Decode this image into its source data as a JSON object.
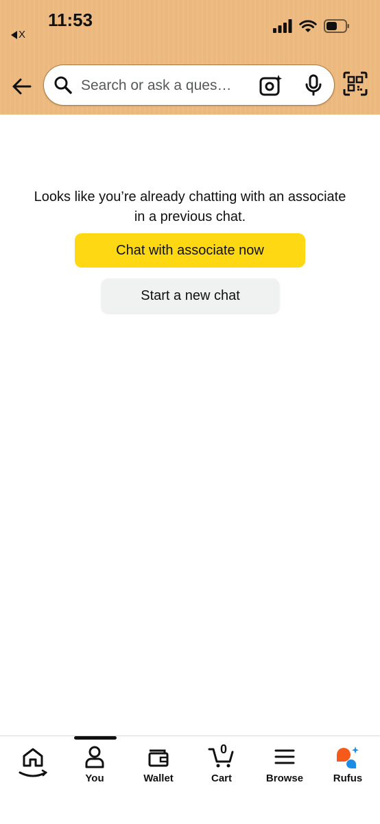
{
  "status_bar": {
    "time": "11:53",
    "back_app": "X"
  },
  "search": {
    "placeholder": "Search or ask a ques…"
  },
  "message": {
    "line1": "Looks like you’re already chatting with an associate",
    "line2": "in a previous chat."
  },
  "buttons": {
    "associate_label": "Chat with associate now",
    "new_chat_label": "Start a new chat"
  },
  "nav": {
    "you": "You",
    "wallet": "Wallet",
    "cart": "Cart",
    "cart_count": "0",
    "browse": "Browse",
    "rufus": "Rufus"
  },
  "colors": {
    "header_bg": "#ecb87d",
    "primary_button": "#ffd814",
    "secondary_button": "#f0f2f2",
    "rufus_orange": "#f65a1a",
    "rufus_blue": "#1a8ce5"
  }
}
